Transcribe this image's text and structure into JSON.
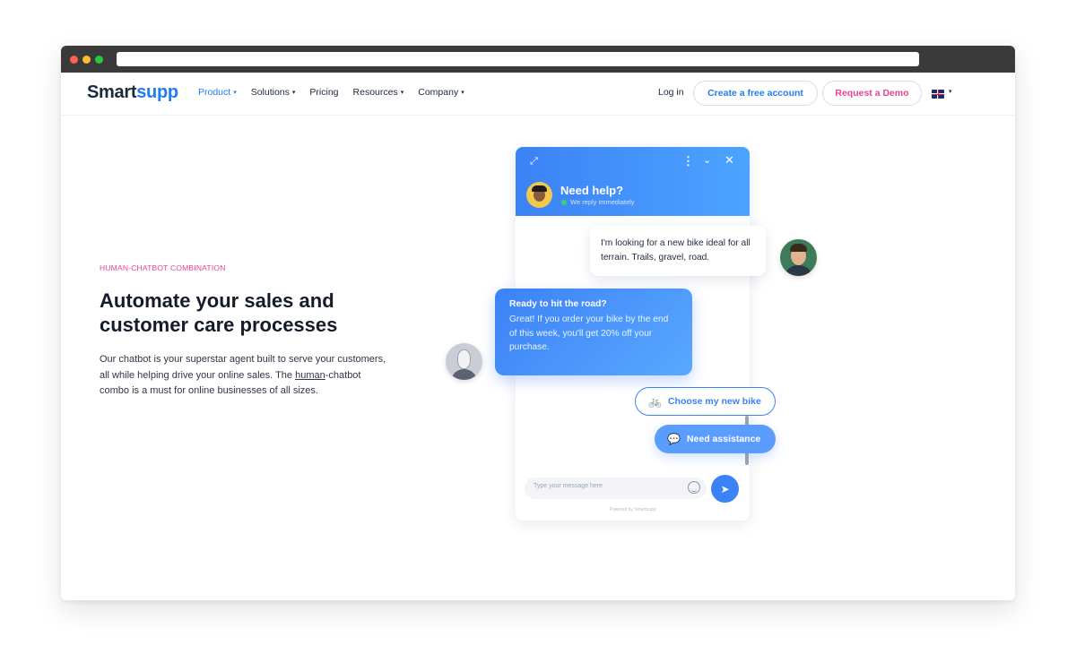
{
  "browser": {
    "url": ""
  },
  "nav": {
    "logo_part1": "Smart",
    "logo_part2": "supp",
    "menu": [
      {
        "label": "Product",
        "caret": "▾"
      },
      {
        "label": "Solutions",
        "caret": "▾"
      },
      {
        "label": "Pricing",
        "caret": ""
      },
      {
        "label": "Resources",
        "caret": "▾"
      },
      {
        "label": "Company",
        "caret": "▾"
      }
    ],
    "login": "Log in",
    "cta_free": "Create a free account",
    "cta_demo": "Request a Demo",
    "lang_caret": "▾"
  },
  "hero": {
    "eyebrow": "HUMAN-CHATBOT COMBINATION",
    "headline": "Automate your sales and customer care processes",
    "body_before": "Our chatbot is your superstar agent built to serve your customers, all while helping drive your online sales. The ",
    "body_link": "human",
    "body_after": "-chatbot combo is a must for online businesses of all sizes."
  },
  "chat": {
    "header_title": "Need help?",
    "header_status": "We reply immediately",
    "user_message": "I'm looking for a new bike ideal for all terrain. Trails, gravel, road.",
    "bot_title": "Ready to hit the road?",
    "bot_message": "Great! If you order your bike by the end of this week, you'll get 20% off your purchase.",
    "chip_bike": "Choose my new bike",
    "chip_assist": "Need assistance",
    "input_placeholder": "Type your message here",
    "powered_by": "Powered by Smartsupp"
  },
  "colors": {
    "accent": "#3b82f6",
    "pink": "#e84393",
    "text": "#141b2b"
  }
}
